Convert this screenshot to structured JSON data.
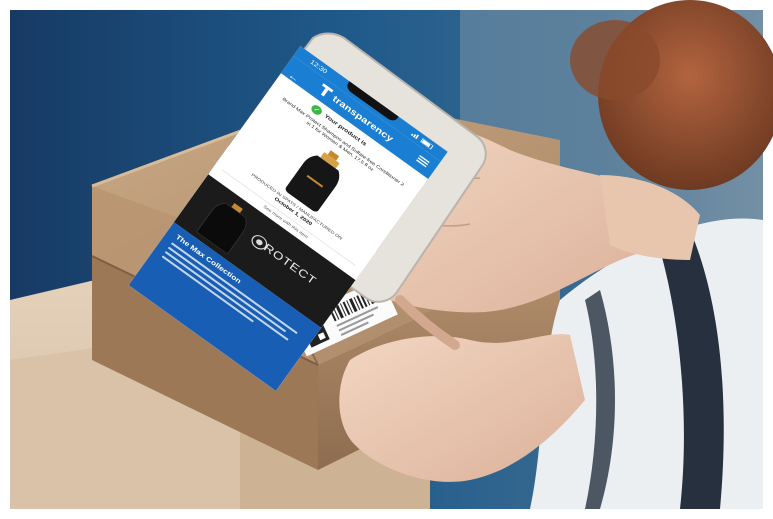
{
  "app": {
    "status_time": "12:30",
    "brand_name": "transparency",
    "verified_text": "Your product is",
    "product_title": "Brand Max Protect Shampoo and Sulfate-free Conditioner 2 in 1 for Women & Men, 17.5 fl oz",
    "meta_label": "PRODUCED IN SPATS / MANUFACTURED ON",
    "meta_value": "October 1, 2020",
    "caption": "See more with this item",
    "promo_text": "ROTECT",
    "collection_title": "The Max Collection"
  },
  "colors": {
    "brand_blue": "#1a7fd2",
    "verified_green": "#3cb54a",
    "collection_blue": "#175eb4"
  },
  "icons": [
    "back-arrow-icon",
    "transparency-logo-icon",
    "menu-icon",
    "check-icon",
    "qr-code-icon",
    "barcode-icon"
  ]
}
